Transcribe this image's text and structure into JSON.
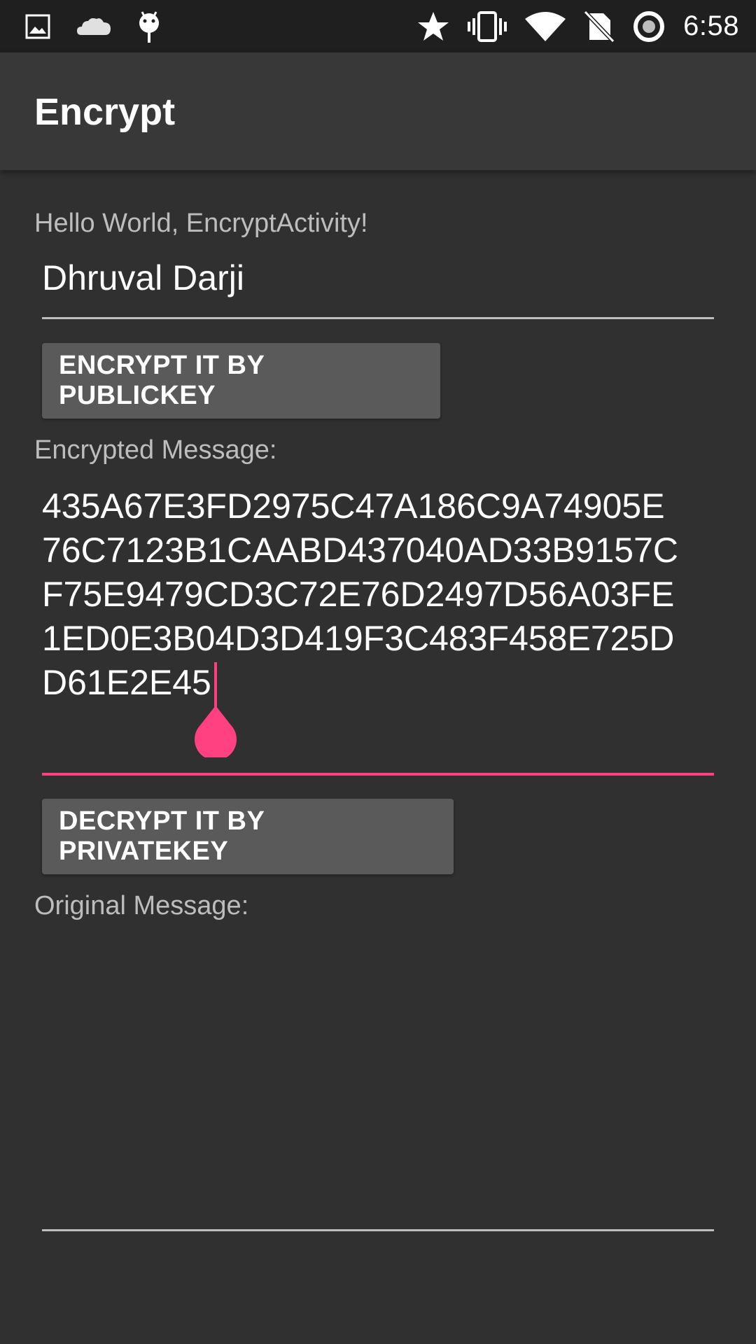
{
  "status_bar": {
    "time": "6:58",
    "left_icons": [
      "image-icon",
      "cloud-icon",
      "android-icon"
    ],
    "right_icons": [
      "star-icon",
      "vibrate-icon",
      "wifi-icon",
      "no-sim-icon",
      "sync-icon"
    ]
  },
  "app_bar": {
    "title": "Encrypt"
  },
  "main": {
    "greeting": "Hello World, EncryptActivity!",
    "input_value": "Dhruval Darji",
    "encrypt_button_label": "ENCRYPT IT BY PUBLICKEY",
    "encrypted_label": "Encrypted Message:",
    "encrypted_lines": [
      "435A67E3FD2975C47A186C9A74905E",
      "76C7123B1CAABD437040AD33B9157C",
      "F75E9479CD3C72E76D2497D56A03FE",
      "1ED0E3B04D3D419F3C483F458E725D",
      "D61E2E45"
    ],
    "decrypt_button_label": "DECRYPT IT BY PRIVATEKEY",
    "original_label": "Original Message:",
    "original_value": ""
  },
  "colors": {
    "accent": "#ff4081",
    "background": "#303030",
    "app_bar": "#383838",
    "status_bar": "#1f1f1f",
    "button": "#5a5a5a"
  }
}
